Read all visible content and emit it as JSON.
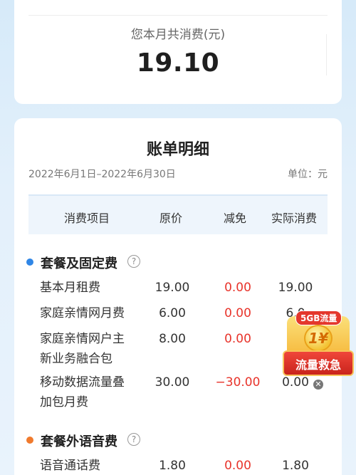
{
  "summary": {
    "label": "您本月共消费(元)",
    "amount": "19.10"
  },
  "detail": {
    "title": "账单明细",
    "period": "2022年6月1日–2022年6月30日",
    "unit": "单位：元",
    "headers": {
      "item": "消费项目",
      "original": "原价",
      "reduction": "减免",
      "actual": "实际消费"
    },
    "sections": [
      {
        "title": "套餐及固定费",
        "dot_color": "#2f86e6",
        "help": "?",
        "rows": [
          {
            "name": "基本月租费",
            "original": "19.00",
            "reduction": "0.00",
            "actual": "19.00"
          },
          {
            "name": "家庭亲情网月费",
            "original": "6.00",
            "reduction": "0.00",
            "actual": "6.0"
          },
          {
            "name_line1": "家庭亲情网户主",
            "name_line2": "新业务融合包",
            "original": "8.00",
            "reduction": "0.00"
          },
          {
            "name_line1": "移动数据流量叠",
            "name_line2": "加包月费",
            "original": "30.00",
            "reduction": "−30.00",
            "actual": "0.00"
          }
        ]
      },
      {
        "title": "套餐外语音费",
        "dot_color": "#f07a2d",
        "help": "?",
        "rows": [
          {
            "name": "语音通话费",
            "original": "1.80",
            "reduction": "0.00",
            "actual": "1.80"
          }
        ]
      }
    ]
  },
  "promo": {
    "tag": "5GB流量",
    "coin": "1¥",
    "label": "流量救急",
    "close": "✕"
  }
}
